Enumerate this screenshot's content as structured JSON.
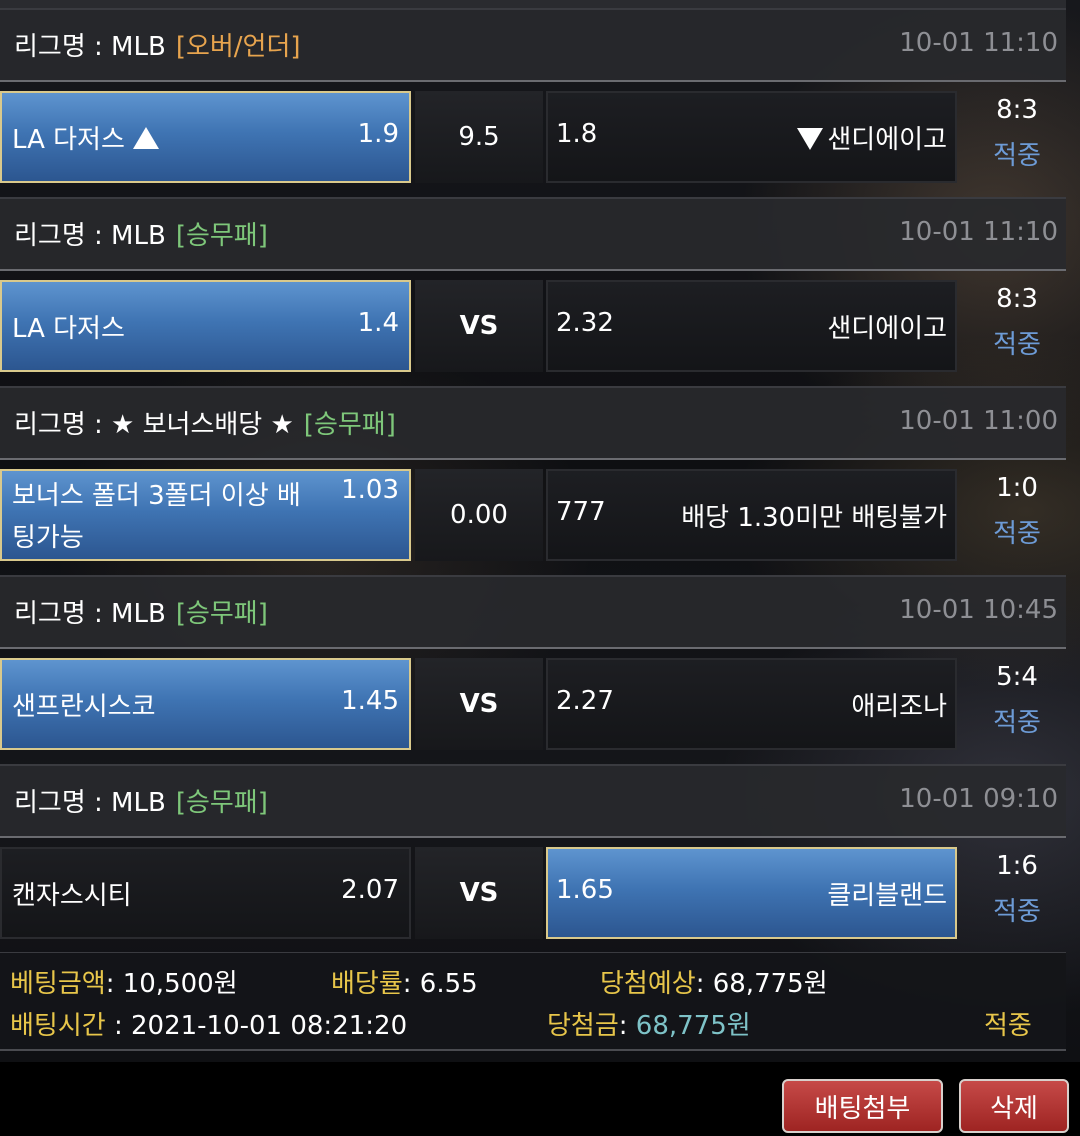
{
  "colors": {
    "tag_overunder": "#e7a44e",
    "tag_winlose": "#7ec77a",
    "selected": "#3f74b3",
    "status": "#6d9bd6",
    "summary_label": "#e8c64a",
    "win_amount": "#7ec3c8"
  },
  "bets": [
    {
      "league": "리그명 : MLB",
      "tag": "[오버/언더]",
      "time": "10-01 11:10",
      "home": "LA 다저스",
      "home_odd": "1.9",
      "mid": "9.5",
      "away_odd": "1.8",
      "away": "샌디에이고",
      "score": "8:3",
      "status": "적중",
      "selected": "home",
      "home_icon": "triangle-up",
      "away_icon": "triangle-down"
    },
    {
      "league": "리그명 : MLB",
      "tag": "[승무패]",
      "time": "10-01 11:10",
      "home": "LA 다저스",
      "home_odd": "1.4",
      "mid": "VS",
      "away_odd": "2.32",
      "away": "샌디에이고",
      "score": "8:3",
      "status": "적중",
      "selected": "home"
    },
    {
      "league": "리그명 : ★ 보너스배당 ★",
      "tag": "[승무패]",
      "time": "10-01 11:00",
      "home": "보너스 폴더 3폴더 이상 배팅가능",
      "home_odd": "1.03",
      "mid": "0.00",
      "away_odd": "777",
      "away": "배당 1.30미만 배팅불가",
      "score": "1:0",
      "status": "적중",
      "selected": "home"
    },
    {
      "league": "리그명 : MLB",
      "tag": "[승무패]",
      "time": "10-01 10:45",
      "home": "샌프란시스코",
      "home_odd": "1.45",
      "mid": "VS",
      "away_odd": "2.27",
      "away": "애리조나",
      "score": "5:4",
      "status": "적중",
      "selected": "home"
    },
    {
      "league": "리그명 : MLB",
      "tag": "[승무패]",
      "time": "10-01 09:10",
      "home": "캔자스시티",
      "home_odd": "2.07",
      "mid": "VS",
      "away_odd": "1.65",
      "away": "클리블랜드",
      "score": "1:6",
      "status": "적중",
      "selected": "away"
    }
  ],
  "summary": {
    "amount_label": "베팅금액",
    "amount_value": "10,500원",
    "rate_label": "배당률",
    "rate_value": "6.55",
    "expected_label": "당첨예상",
    "expected_value": "68,775원",
    "time_label": "배팅시간",
    "time_value": "2021-10-01 08:21:20",
    "win_label": "당첨금",
    "win_value": "68,775원",
    "result": "적중"
  },
  "buttons": {
    "attach": "배팅첨부",
    "delete": "삭제"
  }
}
